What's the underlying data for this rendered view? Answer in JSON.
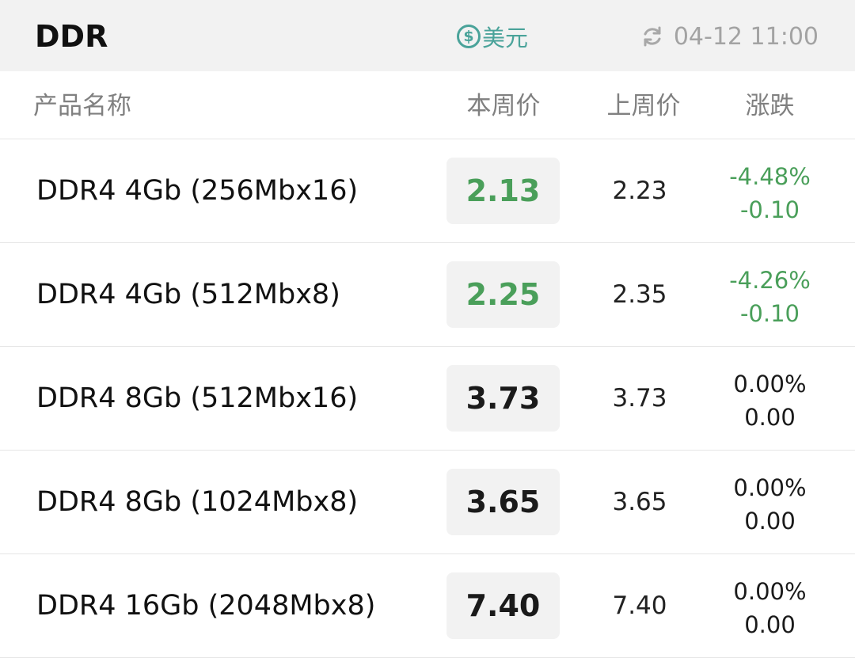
{
  "header": {
    "title": "DDR",
    "currency_label": "美元",
    "currency_icon": "dollar-coin-icon",
    "refresh_icon": "refresh-icon",
    "updated": "04-12 11:00"
  },
  "columns": {
    "name": "产品名称",
    "this_week": "本周价",
    "last_week": "上周价",
    "change": "涨跌"
  },
  "colors": {
    "accent": "#4aa39a",
    "down": "#4a9f5a",
    "flat": "#1a1a1a"
  },
  "rows": [
    {
      "name": "DDR4 4Gb (256Mbx16)",
      "this_week": "2.13",
      "last_week": "2.23",
      "change_pct": "-4.48%",
      "change_abs": "-0.10",
      "trend": "down"
    },
    {
      "name": "DDR4 4Gb (512Mbx8)",
      "this_week": "2.25",
      "last_week": "2.35",
      "change_pct": "-4.26%",
      "change_abs": "-0.10",
      "trend": "down"
    },
    {
      "name": "DDR4 8Gb (512Mbx16)",
      "this_week": "3.73",
      "last_week": "3.73",
      "change_pct": "0.00%",
      "change_abs": "0.00",
      "trend": "flat"
    },
    {
      "name": "DDR4 8Gb (1024Mbx8)",
      "this_week": "3.65",
      "last_week": "3.65",
      "change_pct": "0.00%",
      "change_abs": "0.00",
      "trend": "flat"
    },
    {
      "name": "DDR4 16Gb (2048Mbx8)",
      "this_week": "7.40",
      "last_week": "7.40",
      "change_pct": "0.00%",
      "change_abs": "0.00",
      "trend": "flat"
    }
  ]
}
